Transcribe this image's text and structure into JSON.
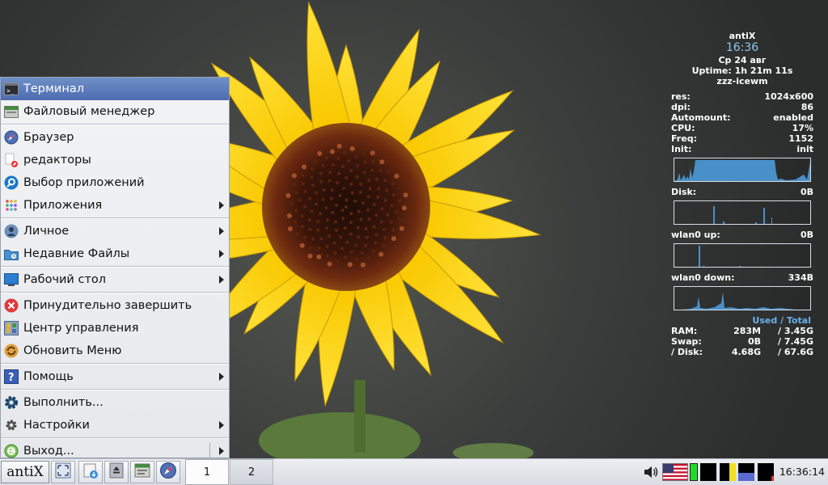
{
  "menu": {
    "items": [
      {
        "id": "terminal",
        "label": "Терминал",
        "icon": "terminal-icon",
        "submenu": false,
        "selected": true
      },
      {
        "id": "filemanager",
        "label": "Файловый менеджер",
        "icon": "file-manager-icon",
        "submenu": false
      },
      {
        "sep": true
      },
      {
        "id": "browser",
        "label": "Браузер",
        "icon": "browser-compass-icon",
        "submenu": false
      },
      {
        "id": "editors",
        "label": "редакторы",
        "icon": "editor-icon",
        "submenu": false
      },
      {
        "id": "appselect",
        "label": "Выбор приложений",
        "icon": "app-search-icon",
        "submenu": false
      },
      {
        "id": "applications",
        "label": "Приложения",
        "icon": "applications-grid-icon",
        "submenu": true
      },
      {
        "sep": true
      },
      {
        "id": "personal",
        "label": "Личное",
        "icon": "personal-user-icon",
        "submenu": true
      },
      {
        "id": "recent",
        "label": "Недавние Файлы",
        "icon": "recent-folder-icon",
        "submenu": true
      },
      {
        "sep": true
      },
      {
        "id": "desktop",
        "label": "Рабочий стол",
        "icon": "desktop-icon",
        "submenu": true
      },
      {
        "sep": true
      },
      {
        "id": "forcequit",
        "label": "Принудительно завершить",
        "icon": "force-quit-icon",
        "submenu": false
      },
      {
        "id": "controlcenter",
        "label": "Центр управления",
        "icon": "control-center-icon",
        "submenu": false
      },
      {
        "id": "refreshmenu",
        "label": "Обновить Меню",
        "icon": "refresh-icon",
        "submenu": false
      },
      {
        "sep": true
      },
      {
        "id": "help",
        "label": "Помощь",
        "icon": "help-icon",
        "submenu": true
      },
      {
        "sep": true
      },
      {
        "id": "run",
        "label": "Выполнить...",
        "icon": "run-gear-icon",
        "submenu": false
      },
      {
        "id": "settings",
        "label": "Настройки",
        "icon": "settings-gear-icon",
        "submenu": true
      },
      {
        "sep": true
      },
      {
        "id": "logout",
        "label": "Выход...",
        "icon": "logout-icon",
        "submenu": true
      }
    ]
  },
  "taskbar": {
    "start_label": "antiX",
    "workspaces": [
      "1",
      "2"
    ],
    "clock": "16:36:14",
    "quicklaunch": [
      "show-desktop-icon",
      "files-install-icon",
      "eject-drive-icon",
      "file-manager-icon",
      "browser-compass-icon"
    ]
  },
  "conky": {
    "title": "antiX",
    "time": "16:36",
    "date": "Ср 24 авг",
    "uptime": "Uptime: 1h 21m 11s",
    "wm": "zzz-icewm",
    "stats": [
      {
        "k": "res:",
        "v": "1024x600"
      },
      {
        "k": "dpi:",
        "v": "86"
      },
      {
        "k": "Automount:",
        "v": "enabled"
      },
      {
        "k": "CPU:",
        "v": "17%"
      },
      {
        "k": "Freq:",
        "v": "1152"
      },
      {
        "k": "Init:",
        "v": "init"
      }
    ],
    "disk_label": "Disk:",
    "disk_value": "0B",
    "wlan_up_label": "wlan0 up:",
    "wlan_up_value": "0B",
    "wlan_down_label": "wlan0 down:",
    "wlan_down_value": "334B",
    "used_label": "Used",
    "slash": " / ",
    "total_label": "Total",
    "mem": [
      {
        "k": "RAM:",
        "used": "283M",
        "total": "/ 3.45G"
      },
      {
        "k": "Swap:",
        "used": "0B",
        "total": "/ 7.45G"
      },
      {
        "k": "/ Disk:",
        "used": "4.68G",
        "total": "/ 67.6G"
      }
    ]
  },
  "colors": {
    "menu_selected": "#5a7bbd",
    "conky_accent": "#6ab0e8",
    "graph_fill": "#4a90c8"
  }
}
